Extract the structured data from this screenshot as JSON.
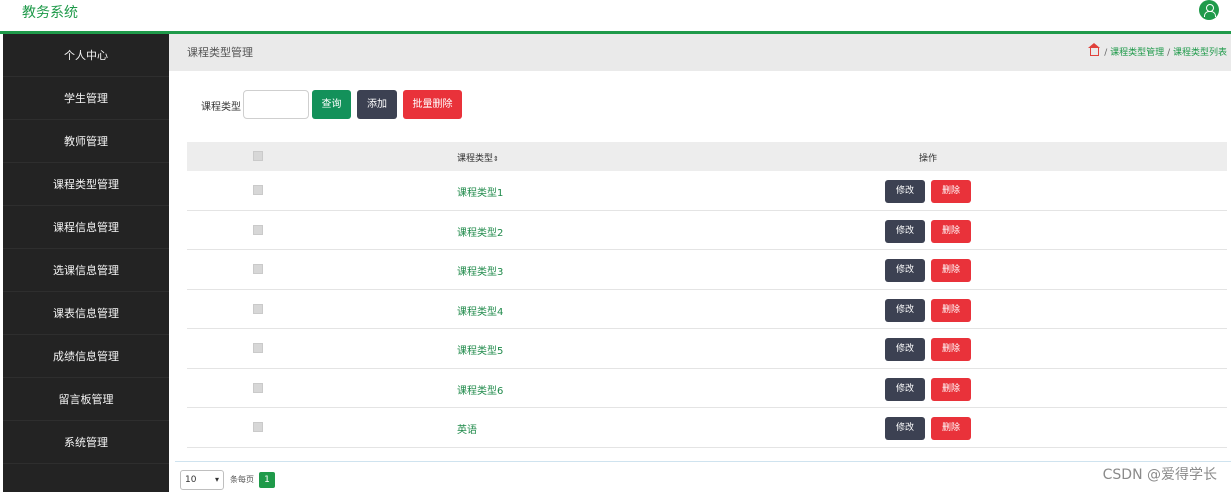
{
  "app": {
    "title": "教务系统"
  },
  "sidebar": {
    "items": [
      {
        "label": "个人中心"
      },
      {
        "label": "学生管理"
      },
      {
        "label": "教师管理"
      },
      {
        "label": "课程类型管理"
      },
      {
        "label": "课程信息管理"
      },
      {
        "label": "选课信息管理"
      },
      {
        "label": "课表信息管理"
      },
      {
        "label": "成绩信息管理"
      },
      {
        "label": "留言板管理"
      },
      {
        "label": "系统管理"
      }
    ]
  },
  "header": {
    "page_title": "课程类型管理",
    "breadcrumb": {
      "sep": "/",
      "item1": "课程类型管理",
      "item2": "课程类型列表"
    }
  },
  "search": {
    "label": "课程类型",
    "value": "",
    "query_button": "查询",
    "add_button": "添加",
    "bulk_delete_button": "批量删除"
  },
  "table": {
    "columns": {
      "type": "课程类型",
      "sort_glyph": "⇕",
      "actions": "操作"
    },
    "rows": [
      {
        "type": "课程类型1"
      },
      {
        "type": "课程类型2"
      },
      {
        "type": "课程类型3"
      },
      {
        "type": "课程类型4"
      },
      {
        "type": "课程类型5"
      },
      {
        "type": "课程类型6"
      },
      {
        "type": "英语"
      }
    ],
    "edit_label": "修改",
    "delete_label": "删除"
  },
  "pagination": {
    "page_size": "10",
    "per_page_label": "条每页",
    "current_page": "1"
  },
  "watermark": "CSDN @爱得学长",
  "colors": {
    "accent": "#1f9a4a",
    "danger": "#e9323a",
    "dark": "#3c4152",
    "sidebar_bg": "#232323"
  }
}
